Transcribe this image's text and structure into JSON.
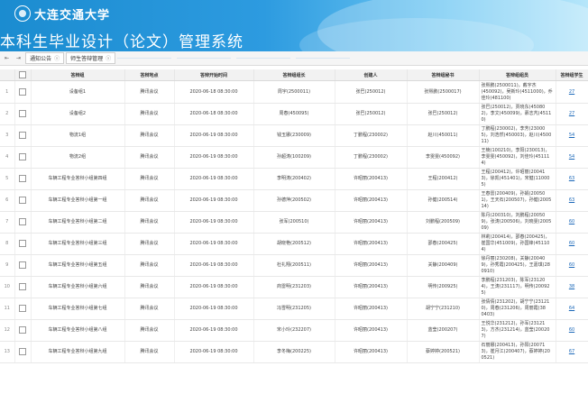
{
  "header": {
    "university": "大连交通大学",
    "system_title": "本科生毕业设计（论文）管理系统"
  },
  "tabs": [
    {
      "label": "通知公告",
      "close": "ⓧ"
    },
    {
      "label": "师生答辩管理",
      "close": "ⓧ"
    }
  ],
  "table": {
    "columns": [
      "答辩组",
      "答辩地点",
      "答辩开始时间",
      "答辩组组长",
      "创建人",
      "答辩组秘书",
      "答辩组组员",
      "答辩组学生"
    ],
    "rows": [
      {
        "no": "1",
        "group": "设备组1",
        "place": "腾讯会议",
        "time": "2020-06-18 08:30:00",
        "leader": "周宇(2500011)",
        "creator": "张巴(250012)",
        "secretary": "张熙鹏(2500017)",
        "members": "张熙鹏(2500011)，戴宇杰(450092)，吴新玲(4511000)，乔佳玲(481100)",
        "count": "27"
      },
      {
        "no": "2",
        "group": "设备组2",
        "place": "腾讯会议",
        "time": "2020-06-18 08:30:00",
        "leader": "周春(450095)",
        "creator": "张巴(250012)",
        "secretary": "张巴(250012)",
        "members": "张巴(250012)，贾晓东(45080 2)，李文(450099)，慕志芃(4511 0)",
        "count": "27"
      },
      {
        "no": "3",
        "group": "物流1组",
        "place": "腾讯会议",
        "time": "2020-06-19 08:30:00",
        "leader": "钱玉娜(230009)",
        "creator": "丁鹏程(230002)",
        "secretary": "赵川(450011)",
        "members": "丁鹏程(230002)，李芳(23000 5)，刘浩然(450003)，赵川(4500 11)",
        "count": "54"
      },
      {
        "no": "4",
        "group": "物流2组",
        "place": "腾讯会议",
        "time": "2020-06-19 08:30:00",
        "leader": "孙超涛(100209)",
        "creator": "丁鹏程(230002)",
        "secretary": "李雯雯(450092)",
        "members": "王楠(100210)，李阳(230013)，李雯雯(450092)，刘佳玲(45111 4)",
        "count": "54"
      },
      {
        "no": "5",
        "group": "车辆工程专业答辩小组第四组",
        "place": "腾讯会议",
        "time": "2020-06-19 08:30:00",
        "leader": "李明涛(200402)",
        "creator": "许昭丽(200413)",
        "secretary": "王程(200412)",
        "members": "王程(200412)，许昭丽(20041 3)，徐凯(451401)，宋健(11000 5)",
        "count": "63"
      },
      {
        "no": "6",
        "group": "车辆工程专业答辩小组第一组",
        "place": "腾讯会议",
        "time": "2020-06-19 08:30:00",
        "leader": "孙德萍(200502)",
        "creator": "许昭丽(200413)",
        "secretary": "孙健(200514)",
        "members": "王春雷(200409)，孙娟(20050 1)，王天石(200507)，孙健(2005 14)",
        "count": "63"
      },
      {
        "no": "7",
        "group": "车辆工程专业答辩小组第二组",
        "place": "腾讯会议",
        "time": "2020-06-19 08:30:00",
        "leader": "张军(200510)",
        "creator": "许昭丽(200413)",
        "secretary": "刘鹏程(200509)",
        "members": "陈丹(200310)，刘鹏程(20050 9)，张涛(200506)，刘晓雯(2005 09)",
        "count": "60"
      },
      {
        "no": "8",
        "group": "车辆工程专业答辩小组第三组",
        "place": "腾讯会议",
        "time": "2020-06-19 08:30:00",
        "leader": "胡晓艳(200512)",
        "creator": "许昭丽(200413)",
        "secretary": "邵春(200425)",
        "members": "林莉(200414)，邵春(200425)，崔国华(451009)，孙国锋(45110 4)",
        "count": "60"
      },
      {
        "no": "9",
        "group": "车辆工程专业答辩小组第五组",
        "place": "腾讯会议",
        "time": "2020-06-19 08:30:00",
        "leader": "杜礼翔(200511)",
        "creator": "许昭丽(200413)",
        "secretary": "关静(200409)",
        "members": "徐丹丽(230208)，关静(20040 9)，孙秀霞(200425)，王嘉琪(28 0910)",
        "count": "60"
      },
      {
        "no": "10",
        "group": "车辆工程专业答辩小组第六组",
        "place": "腾讯会议",
        "time": "2020-06-19 08:30:00",
        "leader": "商雷明(231203)",
        "creator": "许昭丽(200413)",
        "secretary": "明传(200925)",
        "members": "李鹏程(231203)，陈军(23120 4)，王涛(231117)，明传(20092 5)",
        "count": "38"
      },
      {
        "no": "11",
        "group": "车辆工程专业答辩小组第七组",
        "place": "腾讯会议",
        "time": "2020-06-19 08:30:00",
        "leader": "冯雪明(231205)",
        "creator": "许昭丽(200413)",
        "secretary": "胡宁宁(231210)",
        "members": "张倩倩(231202)，胡宁宁(23121 0)，周春(231206)，周丽霞(38 0403)",
        "count": "64"
      },
      {
        "no": "12",
        "group": "车辆工程专业答辩小组第八组",
        "place": "腾讯会议",
        "time": "2020-06-19 08:30:00",
        "leader": "宋小玲(232207)",
        "creator": "许昭丽(200413)",
        "secretary": "蓝莹(200207)",
        "members": "王悦华(231212)，孙军(23121 3)，方杰(231214)，蓝莹(20020 7)",
        "count": "60"
      },
      {
        "no": "13",
        "group": "车辆工程专业答辩小组第九组",
        "place": "腾讯会议",
        "time": "2020-06-19 08:30:00",
        "leader": "李冬梅(200225)",
        "creator": "许昭丽(200413)",
        "secretary": "蔡婷婷(200521)",
        "members": "石丽娜(200413)，孙阳(20071 3)，崔月江(200407)，蔡婷婷(20 0521)",
        "count": "67"
      }
    ]
  }
}
